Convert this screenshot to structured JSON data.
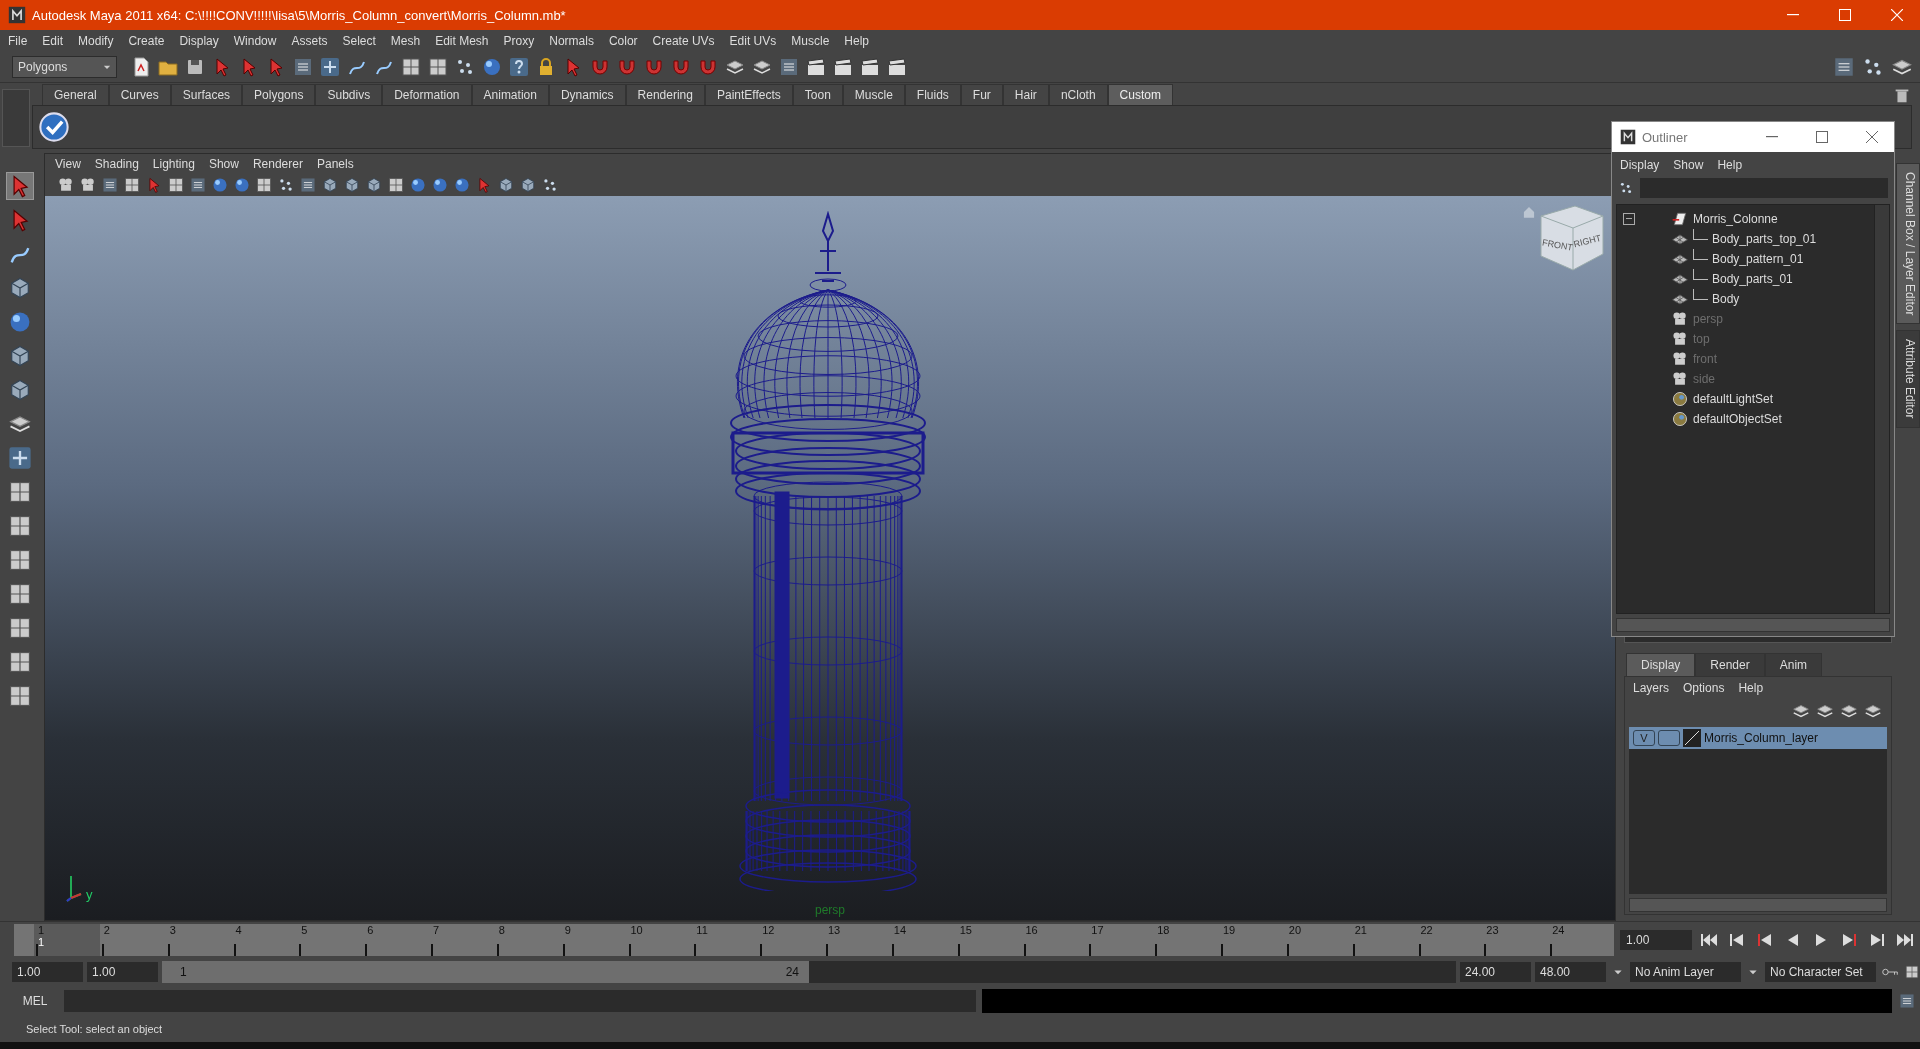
{
  "window": {
    "title": "Autodesk Maya 2011 x64: C:\\!!!!CONV!!!!!\\lisa\\5\\Morris_Column_convert\\Morris_Column.mb*"
  },
  "menu_bar": [
    "File",
    "Edit",
    "Modify",
    "Create",
    "Display",
    "Window",
    "Assets",
    "Select",
    "Mesh",
    "Edit Mesh",
    "Proxy",
    "Normals",
    "Color",
    "Create UVs",
    "Edit UVs",
    "Muscle",
    "Help"
  ],
  "mode_menu": {
    "value": "Polygons"
  },
  "shelf_tabs": [
    {
      "label": "General",
      "selected": false
    },
    {
      "label": "Curves",
      "selected": false
    },
    {
      "label": "Surfaces",
      "selected": false
    },
    {
      "label": "Polygons",
      "selected": false
    },
    {
      "label": "Subdivs",
      "selected": false
    },
    {
      "label": "Deformation",
      "selected": false
    },
    {
      "label": "Animation",
      "selected": false
    },
    {
      "label": "Dynamics",
      "selected": false
    },
    {
      "label": "Rendering",
      "selected": false
    },
    {
      "label": "PaintEffects",
      "selected": false
    },
    {
      "label": "Toon",
      "selected": false
    },
    {
      "label": "Muscle",
      "selected": false
    },
    {
      "label": "Fluids",
      "selected": false
    },
    {
      "label": "Fur",
      "selected": false
    },
    {
      "label": "Hair",
      "selected": false
    },
    {
      "label": "nCloth",
      "selected": false
    },
    {
      "label": "Custom",
      "selected": true
    }
  ],
  "panel_menu": [
    "View",
    "Shading",
    "Lighting",
    "Show",
    "Renderer",
    "Panels"
  ],
  "viewport": {
    "camera": "persp",
    "view_cube": [
      "FRONT",
      "RIGHT"
    ],
    "axis_label": "y"
  },
  "outliner": {
    "title": "Outliner",
    "menus": [
      "Display",
      "Show",
      "Help"
    ],
    "items": [
      {
        "name": "Morris_Colonne",
        "kind": "group",
        "expanded": true,
        "dimmed": false,
        "children": [
          {
            "name": "Body_parts_top_01",
            "kind": "mesh",
            "dimmed": false
          },
          {
            "name": "Body_pattern_01",
            "kind": "mesh",
            "dimmed": false
          },
          {
            "name": "Body_parts_01",
            "kind": "mesh",
            "dimmed": false
          },
          {
            "name": "Body",
            "kind": "mesh",
            "dimmed": false
          }
        ]
      },
      {
        "name": "persp",
        "kind": "camera",
        "dimmed": true
      },
      {
        "name": "top",
        "kind": "camera",
        "dimmed": true
      },
      {
        "name": "front",
        "kind": "camera",
        "dimmed": true
      },
      {
        "name": "side",
        "kind": "camera",
        "dimmed": true
      },
      {
        "name": "defaultLightSet",
        "kind": "set",
        "dimmed": false
      },
      {
        "name": "defaultObjectSet",
        "kind": "set",
        "dimmed": false
      }
    ]
  },
  "side_tabs": [
    {
      "label": "Channel Box / Layer Editor",
      "selected": true
    },
    {
      "label": "Attribute Editor",
      "selected": false
    }
  ],
  "layer_editor": {
    "tabs": [
      {
        "label": "Display",
        "selected": true
      },
      {
        "label": "Render",
        "selected": false
      },
      {
        "label": "Anim",
        "selected": false
      }
    ],
    "menus": [
      "Layers",
      "Options",
      "Help"
    ],
    "layers": [
      {
        "visibility": "V",
        "name": "Morris_Column_layer",
        "selected": true
      }
    ]
  },
  "timeline": {
    "frames": [
      {
        "label": "1",
        "current": true
      },
      {
        "label": "2",
        "current": false
      },
      {
        "label": "3",
        "current": false
      },
      {
        "label": "4",
        "current": false
      },
      {
        "label": "5",
        "current": false
      },
      {
        "label": "6",
        "current": false
      },
      {
        "label": "7",
        "current": false
      },
      {
        "label": "8",
        "current": false
      },
      {
        "label": "9",
        "current": false
      },
      {
        "label": "10",
        "current": false
      },
      {
        "label": "11",
        "current": false
      },
      {
        "label": "12",
        "current": false
      },
      {
        "label": "13",
        "current": false
      },
      {
        "label": "14",
        "current": false
      },
      {
        "label": "15",
        "current": false
      },
      {
        "label": "16",
        "current": false
      },
      {
        "label": "17",
        "current": false
      },
      {
        "label": "18",
        "current": false
      },
      {
        "label": "19",
        "current": false
      },
      {
        "label": "20",
        "current": false
      },
      {
        "label": "21",
        "current": false
      },
      {
        "label": "22",
        "current": false
      },
      {
        "label": "23",
        "current": false
      },
      {
        "label": "24",
        "current": false
      }
    ],
    "current_frame": "1",
    "current_time": "1.00"
  },
  "range": {
    "level": 0.5,
    "start": "1.00",
    "playback_start": "1.00",
    "range_start": "1",
    "range_end": "24",
    "playback_end": "24.00",
    "end": "48.00",
    "anim_layer": "No Anim Layer",
    "character_set": "No Character Set"
  },
  "command_line": {
    "label": "MEL"
  },
  "help_line": "Select Tool: select an object"
}
